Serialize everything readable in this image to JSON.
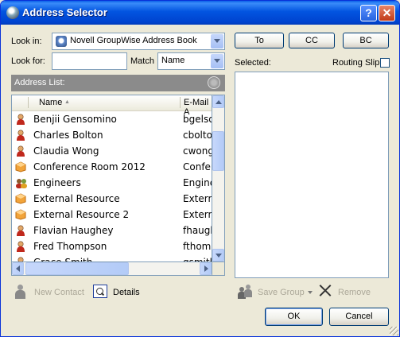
{
  "window": {
    "title": "Address Selector",
    "help_glyph": "?",
    "close_glyph": "✕"
  },
  "look_in": {
    "label": "Look in:",
    "value": "Novell GroupWise Address Book"
  },
  "look_for": {
    "label": "Look for:",
    "value": ""
  },
  "match": {
    "label": "Match",
    "value": "Name"
  },
  "address_list": {
    "label": "Address List:",
    "columns": {
      "name": "Name",
      "sort_glyph": "▲",
      "email": "E-Mail A"
    },
    "rows": [
      {
        "name": "Benjii Gensomino",
        "email": "bgelso",
        "icon": "user-icon"
      },
      {
        "name": "Charles Bolton",
        "email": "cbolton",
        "icon": "user-icon"
      },
      {
        "name": "Claudia Wong",
        "email": "cwong@",
        "icon": "user-icon"
      },
      {
        "name": "Conference Room 2012",
        "email": "Confer",
        "icon": "resource-icon"
      },
      {
        "name": "Engineers",
        "email": "Engine",
        "icon": "group-icon"
      },
      {
        "name": "External Resource",
        "email": "Extern",
        "icon": "resource-icon"
      },
      {
        "name": "External Resource 2",
        "email": "Extern",
        "icon": "resource-icon"
      },
      {
        "name": "Flavian Haughey",
        "email": "fhaugh",
        "icon": "user-icon"
      },
      {
        "name": "Fred Thompson",
        "email": "fthomp",
        "icon": "user-icon"
      },
      {
        "name": "Grace Smith",
        "email": "gsmith",
        "icon": "user-icon"
      }
    ]
  },
  "recipient_buttons": {
    "to": "To",
    "cc": "CC",
    "bc": "BC"
  },
  "selected": {
    "label": "Selected:"
  },
  "routing_slip": {
    "label": "Routing Slip",
    "checked": false
  },
  "bottom_left": {
    "new_contact": "New Contact",
    "details": "Details"
  },
  "bottom_right": {
    "save_group": "Save Group",
    "remove": "Remove"
  },
  "dialog_buttons": {
    "ok": "OK",
    "cancel": "Cancel"
  }
}
